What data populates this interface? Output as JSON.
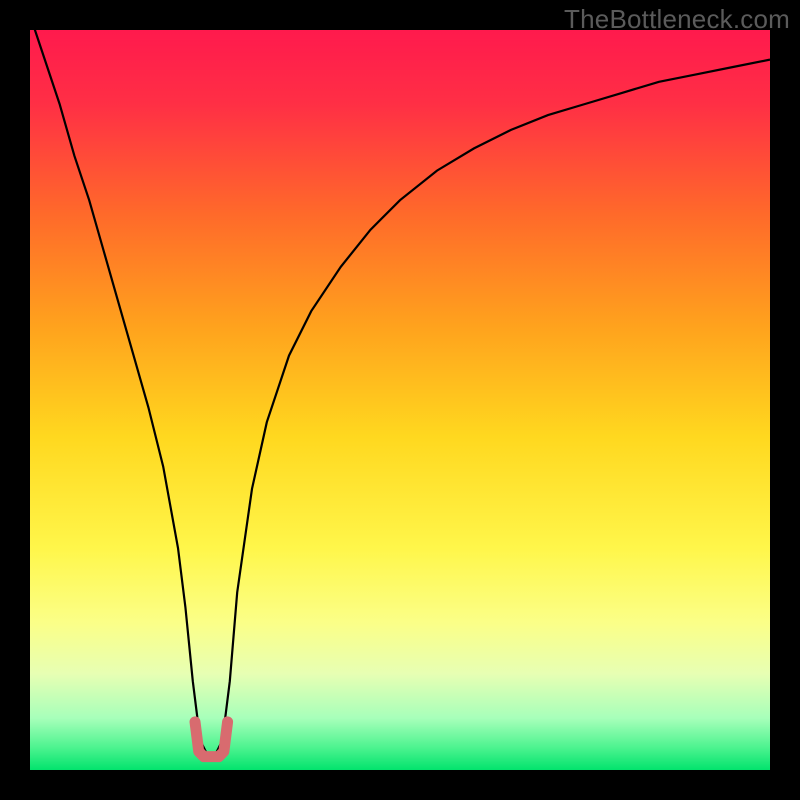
{
  "watermark": "TheBottleneck.com",
  "chart_data": {
    "type": "line",
    "title": "",
    "xlabel": "",
    "ylabel": "",
    "xlim": [
      0,
      100
    ],
    "ylim": [
      0,
      100
    ],
    "grid": false,
    "legend": false,
    "gradient_stops": [
      {
        "offset": 0.0,
        "color": "#ff1a4d"
      },
      {
        "offset": 0.1,
        "color": "#ff2f45"
      },
      {
        "offset": 0.25,
        "color": "#ff6a2a"
      },
      {
        "offset": 0.4,
        "color": "#ffa21d"
      },
      {
        "offset": 0.55,
        "color": "#ffd81f"
      },
      {
        "offset": 0.7,
        "color": "#fff64a"
      },
      {
        "offset": 0.8,
        "color": "#fbff87"
      },
      {
        "offset": 0.87,
        "color": "#e7ffb3"
      },
      {
        "offset": 0.93,
        "color": "#a7ffba"
      },
      {
        "offset": 0.97,
        "color": "#4cf38f"
      },
      {
        "offset": 1.0,
        "color": "#02e36d"
      }
    ],
    "series": [
      {
        "name": "bottleneck-curve",
        "stroke": "#000000",
        "stroke_width": 2.2,
        "x": [
          0,
          2,
          4,
          6,
          8,
          10,
          12,
          14,
          16,
          18,
          20,
          21,
          22,
          23,
          24,
          25,
          26,
          27,
          28,
          30,
          32,
          35,
          38,
          42,
          46,
          50,
          55,
          60,
          65,
          70,
          75,
          80,
          85,
          90,
          95,
          100
        ],
        "y": [
          102,
          96,
          90,
          83,
          77,
          70,
          63,
          56,
          49,
          41,
          30,
          22,
          12,
          4,
          2,
          2,
          4,
          12,
          24,
          38,
          47,
          56,
          62,
          68,
          73,
          77,
          81,
          84,
          86.5,
          88.5,
          90,
          91.5,
          93,
          94,
          95,
          96
        ]
      },
      {
        "name": "bracket-marker",
        "stroke": "#d86b6f",
        "stroke_width": 11,
        "linecap": "round",
        "x": [
          22.3,
          22.8,
          23.5,
          25.5,
          26.2,
          26.7
        ],
        "y": [
          6.5,
          2.5,
          1.8,
          1.8,
          2.5,
          6.5
        ]
      }
    ]
  }
}
